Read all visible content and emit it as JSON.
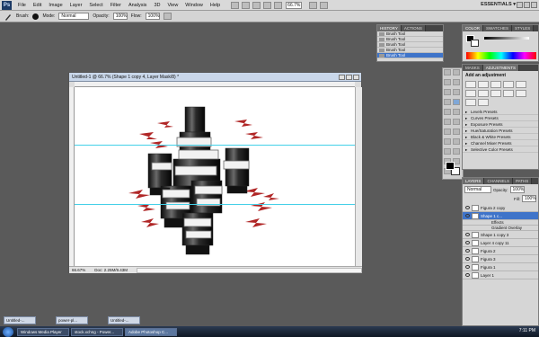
{
  "app": {
    "logo": "Ps",
    "workspace": "ESSENTIALS ▾"
  },
  "menu": [
    "File",
    "Edit",
    "Image",
    "Layer",
    "Select",
    "Filter",
    "Analysis",
    "3D",
    "View",
    "Window",
    "Help"
  ],
  "zoom_box": "66.7%",
  "options": {
    "tool_label": "Brush:",
    "mode_label": "Mode:",
    "mode_value": "Normal",
    "opacity_label": "Opacity:",
    "opacity_value": "100%",
    "flow_label": "Flow:",
    "flow_value": "100%"
  },
  "document": {
    "title": "Untitled-1 @ 66.7% (Shape 1 copy 4, Layer Mask/8) *",
    "status_zoom": "66.67%",
    "status_doc": "Doc: 2.25M/9.43M"
  },
  "history": {
    "tabs": [
      "HISTORY",
      "ACTIONS"
    ],
    "items": [
      "Brush Tool",
      "Brush Tool",
      "Brush Tool",
      "Brush Tool",
      "Brush Tool"
    ]
  },
  "color_panel": {
    "tabs": [
      "COLOR",
      "SWATCHES",
      "STYLES"
    ]
  },
  "adjustments": {
    "tabs": [
      "MASKS",
      "ADJUSTMENTS"
    ],
    "title": "Add an adjustment",
    "presets": [
      "Levels Presets",
      "Curves Presets",
      "Exposure Presets",
      "Hue/Saturation Presets",
      "Black & White Presets",
      "Channel Mixer Presets",
      "Selective Color Presets"
    ]
  },
  "layers": {
    "tabs": [
      "LAYERS",
      "CHANNELS",
      "PATHS"
    ],
    "blend": "Normal",
    "opacity_label": "Opacity:",
    "opacity_value": "100%",
    "fill_label": "Fill:",
    "fill_value": "100%",
    "rows": [
      "Figura 2 copy",
      "Shape 1 c...",
      "Effects",
      "Gradient Overlay",
      "Shape 1 copy 3",
      "Layer 4 copy 11",
      "Figura 2",
      "Figura 3",
      "Figura 1",
      "Layer 1"
    ]
  },
  "mini_docs": [
    "Untitled-...",
    "power-pl...",
    "Untitled-..."
  ],
  "taskbar": {
    "items": [
      "Windows Media Player",
      "stock.xchng - Power...",
      "Adobe Photoshop C..."
    ],
    "clock": "7:11 PM"
  },
  "colors": {
    "accent": "#3f74c9",
    "guide": "#44d0e8",
    "bolt": "#b02626"
  }
}
